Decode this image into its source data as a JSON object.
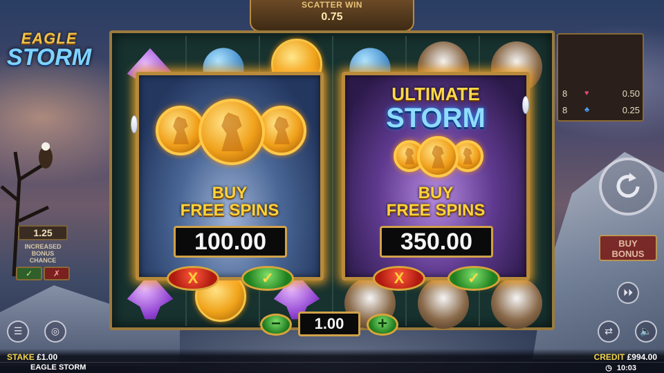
{
  "game": {
    "logo_line1": "EAGLE",
    "logo_line2": "STORM",
    "name": "EAGLE STORM"
  },
  "scatter_win": {
    "label": "SCATTER WIN",
    "value": "0.75"
  },
  "paytable": {
    "rows": [
      {
        "count": "8",
        "suit": "heart",
        "suit_glyph": "♥",
        "amount": "0.50"
      },
      {
        "count": "8",
        "suit": "club",
        "suit_glyph": "♣",
        "amount": "0.25"
      }
    ]
  },
  "increased_bonus": {
    "value": "1.25",
    "caption_line1": "INCREASED",
    "caption_line2": "BONUS",
    "caption_line3": "CHANCE",
    "yes_glyph": "✓",
    "no_glyph": "✗"
  },
  "offers": [
    {
      "id": "free-spins",
      "title_line1": "",
      "title_line2": "",
      "buy_line1": "BUY",
      "buy_line2": "FREE SPINS",
      "price": "100.00",
      "cancel_glyph": "X",
      "confirm_glyph": "✓"
    },
    {
      "id": "ultimate-storm",
      "title_line1": "ULTIMATE",
      "title_line2": "STORM",
      "buy_line1": "BUY",
      "buy_line2": "FREE SPINS",
      "price": "350.00",
      "cancel_glyph": "X",
      "confirm_glyph": "✓"
    }
  ],
  "bet": {
    "minus_glyph": "−",
    "plus_glyph": "+",
    "value": "1.00"
  },
  "controls": {
    "buy_bonus_line1": "BUY",
    "buy_bonus_line2": "BONUS",
    "menu_icon": "☰",
    "coins_icon": "◎",
    "autoplay_icon": "⏵⏵",
    "repeat_icon": "⇄",
    "sound_icon": "🔈"
  },
  "footer": {
    "stake_label": "STAKE",
    "stake_value": "£1.00",
    "credit_label": "CREDIT",
    "credit_value": "£994.00",
    "clock_icon": "◷",
    "time": "10:03"
  },
  "colors": {
    "gold": "#d2a24a",
    "glow": "#ffaa28",
    "confirm_green": "#208020",
    "cancel_red": "#b01a10",
    "label_yellow": "#f2d34a"
  }
}
